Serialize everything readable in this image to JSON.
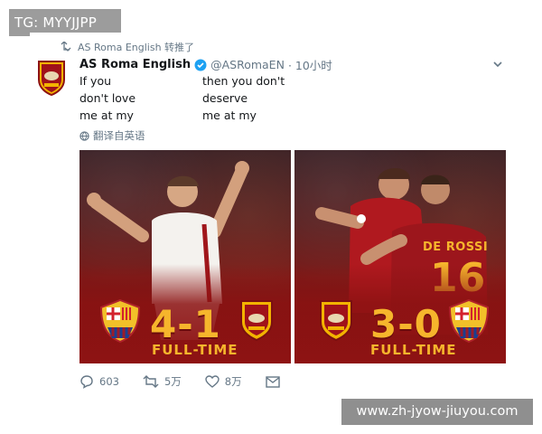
{
  "watermark_top": "TG: MYYJJPP",
  "watermark_bottom": "www.zh-jyow-jiuyou.com",
  "retweet": {
    "label": "AS Roma English 转推了"
  },
  "tweet": {
    "name": "AS Roma English",
    "handle": "@ASRomaEN",
    "time": "· 10小时",
    "lines": [
      [
        "If you",
        "then you don't"
      ],
      [
        "don't love",
        "deserve"
      ],
      [
        "me at my",
        "me at my"
      ]
    ],
    "translate_label": "翻译自英语"
  },
  "media": {
    "left": {
      "score": "4-1",
      "ft": "FULL-TIME"
    },
    "right": {
      "score": "3-0",
      "ft": "FULL-TIME",
      "jersey_name": "DE ROSSI",
      "jersey_number": "16"
    }
  },
  "actions": {
    "reply_count": "603",
    "retweet_count": "5万",
    "like_count": "8万"
  },
  "colors": {
    "twitter_blue": "#1da1f2",
    "roma_red": "#8e1313",
    "score_gold": "#f6b52c"
  }
}
